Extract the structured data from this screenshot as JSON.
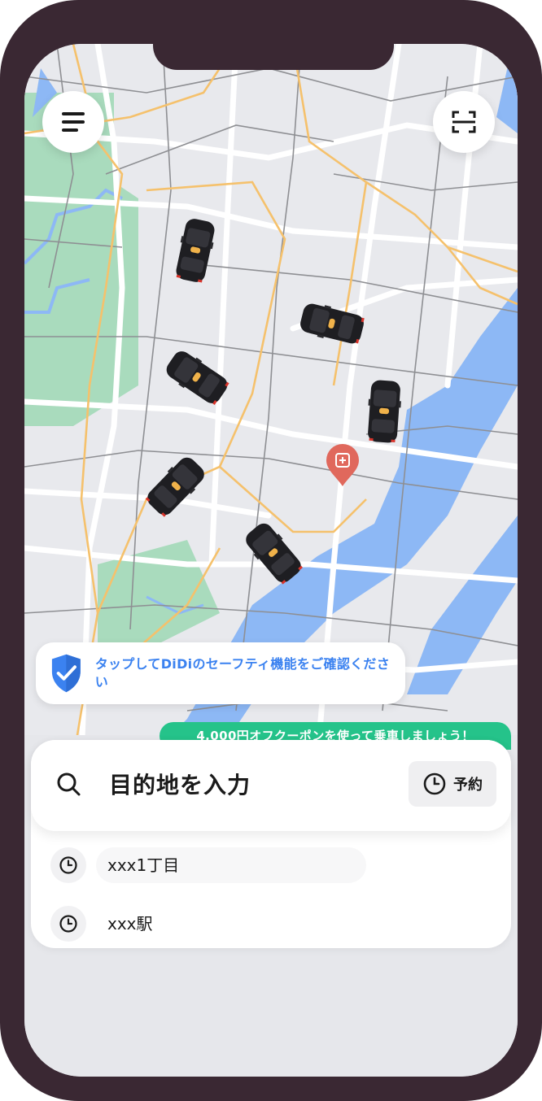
{
  "safety_banner": {
    "text": "タップしてDiDiのセーフティ機能をご確認ください"
  },
  "coupon": {
    "text": "4,000円オフクーポンを使って乗車しましょう！"
  },
  "search": {
    "placeholder": "目的地を入力",
    "reserve_label": "予約"
  },
  "history": [
    {
      "label": "xxx1丁目"
    },
    {
      "label": "xxx駅"
    }
  ],
  "icons": {
    "menu": "menu-icon",
    "scan": "scan-icon",
    "shield": "shield-check-icon",
    "search": "search-icon",
    "clock": "clock-icon",
    "pickup_pin": "hospital-pin-icon",
    "car": "taxi-car-icon"
  },
  "colors": {
    "accent_blue": "#3b82f0",
    "coupon_green": "#25c38a",
    "map_water": "#8db8f5",
    "map_park": "#a9dbbd",
    "pin_red": "#e0685c",
    "frame": "#3a2833"
  }
}
